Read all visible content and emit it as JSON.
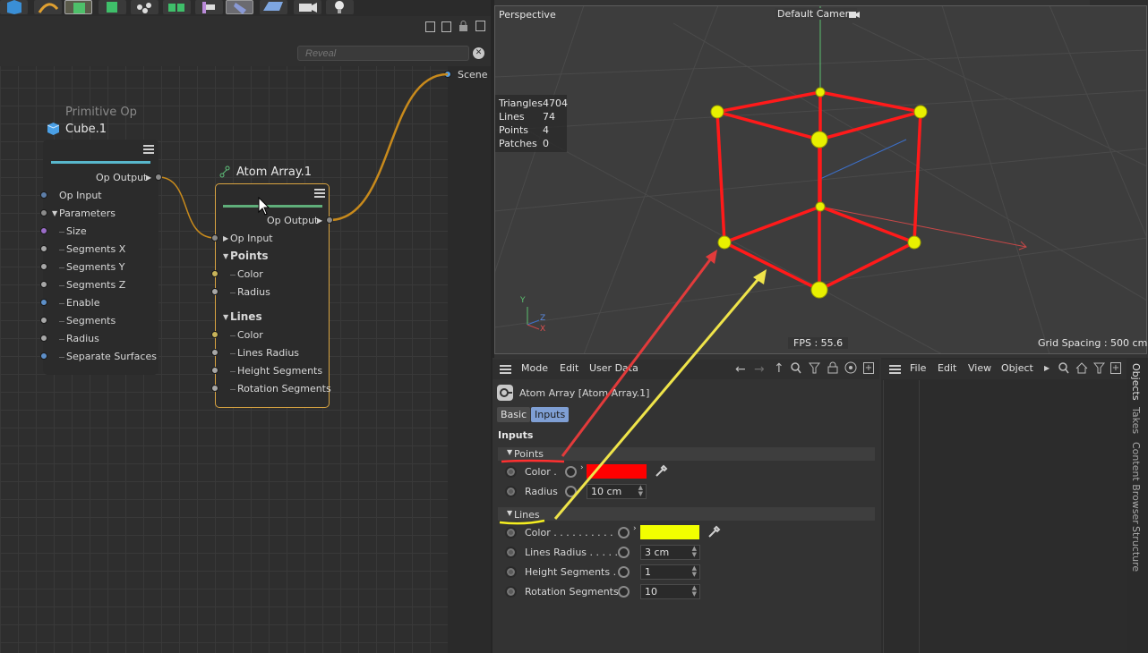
{
  "node_editor": {
    "search_placeholder": "Reveal",
    "scene_label": "Scene",
    "primitive_node": {
      "category": "Primitive Op",
      "title": "Cube.1",
      "output": "Op Output",
      "inputs": [
        "Op Input",
        "Parameters",
        "Size",
        "Segments X",
        "Segments Y",
        "Segments Z",
        "Enable",
        "Segments",
        "Radius",
        "Separate Surfaces"
      ]
    },
    "atom_node": {
      "title": "Atom Array.1",
      "output": "Op Output",
      "op_input": "Op Input",
      "points_group": "Points",
      "points_inputs": [
        "Color",
        "Radius"
      ],
      "lines_group": "Lines",
      "lines_inputs": [
        "Color",
        "Lines Radius",
        "Height Segments",
        "Rotation Segments"
      ]
    }
  },
  "viewport": {
    "view_name": "Perspective",
    "camera": "Default Camera",
    "stats": [
      {
        "label": "Triangles",
        "value": "4704"
      },
      {
        "label": "Lines",
        "value": "74"
      },
      {
        "label": "Points",
        "value": "4"
      },
      {
        "label": "Patches",
        "value": "0"
      }
    ],
    "fps": "FPS : 55.6",
    "grid_spacing": "Grid Spacing : 500 cm",
    "axis_labels": [
      "Y",
      "Z",
      "X"
    ]
  },
  "attribute_manager": {
    "menu": [
      "Mode",
      "Edit",
      "User Data"
    ],
    "object_title": "Atom Array [Atom Array.1]",
    "tabs": [
      "Basic",
      "Inputs"
    ],
    "active_tab": "Inputs",
    "section_title": "Inputs",
    "points": {
      "group": "Points",
      "color_label": "Color .",
      "color_value": "#ff0000",
      "radius_label": "Radius",
      "radius_value": "10 cm"
    },
    "lines": {
      "group": "Lines",
      "color_label": "Color . . . . . . . . . .",
      "color_value": "#f2ff00",
      "lines_radius_label": "Lines Radius . . . . .",
      "lines_radius_value": "3 cm",
      "height_segments_label": "Height Segments . .",
      "height_segments_value": "1",
      "rotation_segments_label": "Rotation Segments",
      "rotation_segments_value": "10"
    }
  },
  "objects_panel": {
    "menu": [
      "File",
      "Edit",
      "View",
      "Object"
    ],
    "side_tabs": [
      "Objects",
      "Takes",
      "Content Browser",
      "Structure"
    ]
  },
  "colors": {
    "wire_orange": "#c88a1c",
    "node_highlight": "#d9a441",
    "primitive_bar": "#58b7cc",
    "atom_bar": "#5fae7a",
    "cube_red": "#ff1a1a",
    "sphere_yellow": "#e8f000",
    "arrow_red": "#e23b3b",
    "arrow_yellow": "#efe44a"
  }
}
